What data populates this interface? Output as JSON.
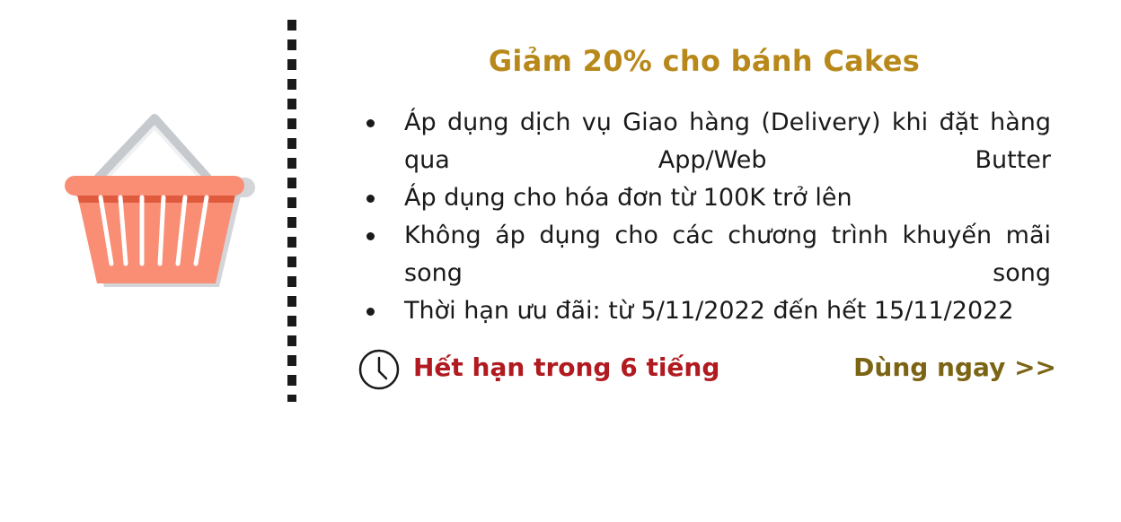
{
  "coupon": {
    "title": "Giảm 20% cho bánh Cakes",
    "conditions": [
      "Áp dụng dịch vụ Giao hàng (Delivery) khi đặt hàng qua App/Web Butter",
      "Áp dụng cho hóa đơn từ 100K trở lên",
      "Không áp dụng cho các chương trình khuyến mãi song song",
      "Thời hạn ưu đãi: từ 5/11/2022 đến hết 15/11/2022"
    ],
    "expiry_text": "Hết hạn trong 6 tiếng",
    "cta_label": "Dùng ngay >>",
    "icons": {
      "basket": "shopping-basket-icon",
      "clock": "clock-icon"
    },
    "colors": {
      "title": "#b8891a",
      "expiry": "#b01a20",
      "cta": "#7b6414",
      "basket": "#f98e74"
    }
  }
}
